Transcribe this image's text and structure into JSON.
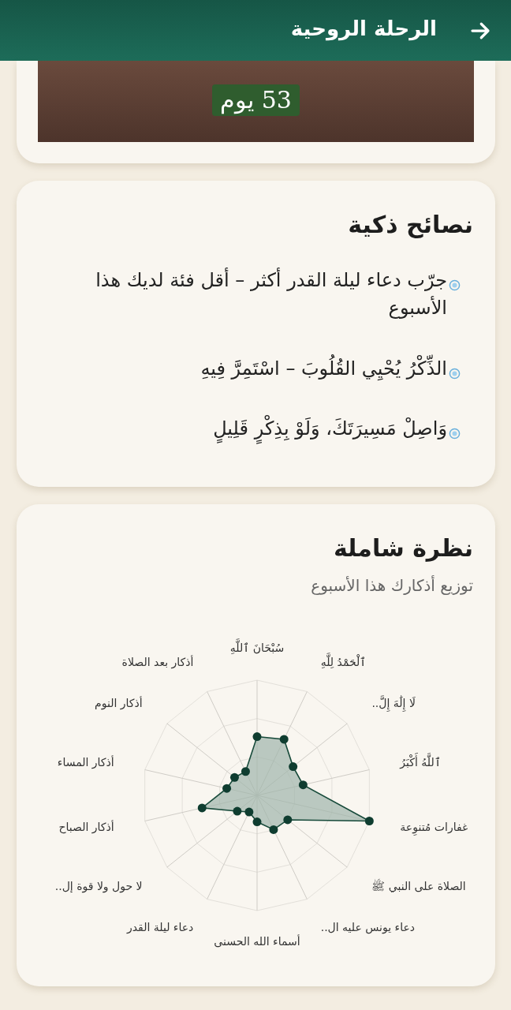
{
  "header": {
    "title": "الرحلة الروحية"
  },
  "streak": {
    "text": "53 يوم"
  },
  "tips_card": {
    "title": "نصائح ذكية",
    "tips": [
      {
        "text": "جرّب دعاء ليلة القدر أكثر – أقل فئة لديك هذا الأسبوع"
      },
      {
        "text": "الذِّكْرُ يُحْيِي القُلُوبَ – اسْتَمِرَّ فِيهِ"
      },
      {
        "text": "وَاصِلْ مَسِيرَتَكَ، وَلَوْ بِذِكْرٍ قَلِيلٍ"
      }
    ]
  },
  "overview_card": {
    "title": "نظرة شاملة",
    "subtitle": "توزيع أذكارك هذا الأسبوع",
    "radar_labels": [
      "سُبْحَانَ ٱللَّهِ",
      "ٱلْحَمْدُ لِلَّهِ",
      "أذكار بعد الصلاة",
      "لَا إِلَٰهَ إِلَّ..",
      "أذكار النوم",
      "ٱللَّهُ أَكْبَرُ",
      "أذكار المساء",
      "غفارات مُتنوِعة",
      "أذكار الصباح",
      "الصلاة على النبي ﷺ",
      "لا حول ولا قوة إل..",
      "دعاء يونس عليه ال..",
      "دعاء ليلة القدر",
      "أسماء الله الحسنى"
    ]
  }
}
